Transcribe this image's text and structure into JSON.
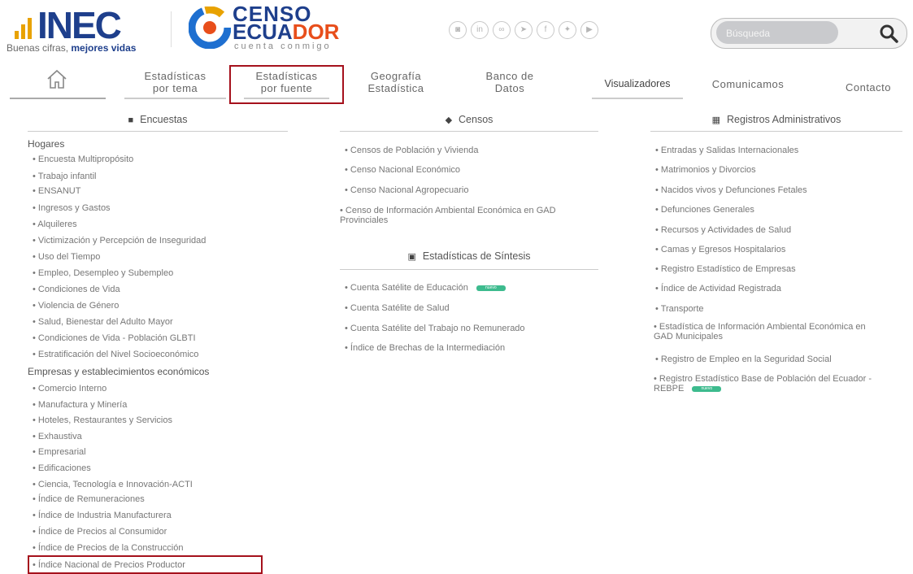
{
  "header": {
    "inec_logo": "INEC",
    "inec_tagline_prefix": "Buenas cifras, ",
    "inec_tagline_bold": "mejores vidas",
    "censo_line1": "CENSO",
    "censo_line2_a": "ECUA",
    "censo_line2_b": "DOR",
    "censo_line3": "cuenta conmigo",
    "social_icons": [
      "instagram-icon",
      "linkedin-icon",
      "flickr-icon",
      "telegram-icon",
      "facebook-icon",
      "twitter-icon",
      "youtube-icon"
    ],
    "search_placeholder": "Búsqueda",
    "accent_color": "#1e3f8c",
    "brand_orange": "#e84e1b",
    "highlight_color": "#a5111c"
  },
  "nav": {
    "home_icon": "home-icon",
    "items": [
      {
        "line1": "Estadísticas",
        "line2": "por tema"
      },
      {
        "line1": "Estadísticas",
        "line2": "por fuente"
      },
      {
        "line1": "Geografía",
        "line2": "Estadística"
      },
      {
        "line1": "Banco de",
        "line2": "Datos"
      },
      {
        "line1": "Visualizadores",
        "line2": ""
      },
      {
        "line1": "Comunicamos",
        "line2": ""
      },
      {
        "line1": "Contacto",
        "line2": ""
      }
    ]
  },
  "encuestas": {
    "title": "Encuestas",
    "hogares_title": "Hogares",
    "hogares": [
      "• Encuesta Multipropósito",
      "• Trabajo infantil",
      "• ENSANUT",
      "• Ingresos y Gastos",
      "• Alquileres",
      "• Victimización y Percepción de Inseguridad",
      "• Uso del Tiempo",
      "• Empleo, Desempleo y Subempleo",
      "• Condiciones de Vida",
      "• Violencia de Género",
      "• Salud, Bienestar del Adulto Mayor",
      "• Condiciones de Vida - Población GLBTI",
      "• Estratificación del Nivel Socioeconómico"
    ],
    "empresas_title": "Empresas y establecimientos económicos",
    "empresas": [
      "• Comercio Interno",
      "• Manufactura y Minería",
      "• Hoteles, Restaurantes y Servicios",
      "• Exhaustiva",
      "• Empresarial",
      "• Edificaciones",
      "• Ciencia, Tecnología e Innovación-ACTI",
      "• Índice de Remuneraciones",
      "• Índice de Industria Manufacturera",
      "• Índice de Precios al Consumidor",
      "• Índice de Precios de la Construcción",
      "• Índice Nacional de Precios Productor"
    ]
  },
  "censos": {
    "title": "Censos",
    "items": [
      "• Censos de Población y Vivienda",
      "• Censo Nacional Económico",
      "• Censo Nacional Agropecuario",
      "• Censo de Información Ambiental Económica en GAD Provinciales"
    ]
  },
  "sintesis": {
    "title": "Estadísticas de Síntesis",
    "items": [
      "• Cuenta Satélite de Educación",
      "• Cuenta Satélite de Salud",
      "• Cuenta Satélite del Trabajo no Remunerado",
      "• Índice de Brechas de la Intermediación"
    ],
    "badge": "nuevo"
  },
  "registros": {
    "title": "Registros Administrativos",
    "items": [
      "• Entradas y Salidas Internacionales",
      "• Matrimonios y Divorcios",
      "• Nacidos vivos y Defunciones Fetales",
      "• Defunciones Generales",
      "• Recursos y Actividades de Salud",
      "• Camas y Egresos Hospitalarios",
      "• Registro Estadístico de Empresas",
      "• Índice de Actividad Registrada",
      "• Transporte",
      "• Estadística de Información Ambiental Económica en GAD Municipales",
      "• Registro de Empleo en la Seguridad Social",
      "• Registro Estadístico Base de Población del Ecuador - REBPE"
    ],
    "badge": "nuevo"
  }
}
